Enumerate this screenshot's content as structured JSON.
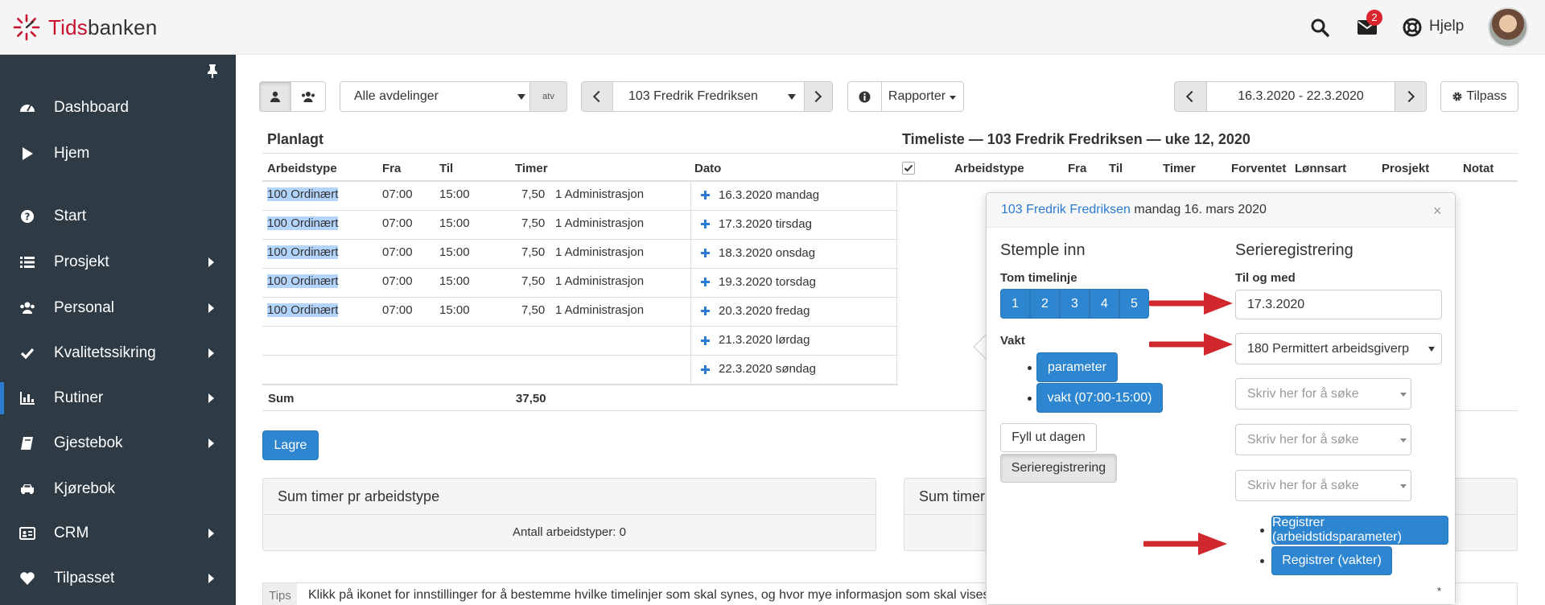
{
  "app": {
    "logo_part1": "Tids",
    "logo_part2": "banken",
    "notifications_count": "2",
    "help_label": "Hjelp"
  },
  "sidebar": {
    "items": [
      {
        "label": "Dashboard",
        "icon": "dashboard-icon",
        "has_submenu": false
      },
      {
        "label": "Hjem",
        "icon": "play-icon",
        "has_submenu": false
      },
      {
        "label": "Start",
        "icon": "question-circle-icon",
        "has_submenu": false
      },
      {
        "label": "Prosjekt",
        "icon": "list-icon",
        "has_submenu": true
      },
      {
        "label": "Personal",
        "icon": "users-icon",
        "has_submenu": true
      },
      {
        "label": "Kvalitetssikring",
        "icon": "check-icon",
        "has_submenu": true
      },
      {
        "label": "Rutiner",
        "icon": "bar-chart-icon",
        "has_submenu": true,
        "active": true
      },
      {
        "label": "Gjestebok",
        "icon": "book-icon",
        "has_submenu": true
      },
      {
        "label": "Kjørebok",
        "icon": "car-icon",
        "has_submenu": false
      },
      {
        "label": "CRM",
        "icon": "id-card-icon",
        "has_submenu": true
      },
      {
        "label": "Tilpasset",
        "icon": "heart-icon",
        "has_submenu": true
      }
    ]
  },
  "toolbar": {
    "department_select": "Alle avdelinger",
    "department_addon": "atv",
    "employee_select": "103 Fredrik Fredriksen",
    "reports_label": "Rapporter",
    "date_range": "16.3.2020 - 22.3.2020",
    "customize_label": "Tilpass"
  },
  "planned": {
    "title": "Planlagt",
    "headers": [
      "Arbeidstype",
      "Fra",
      "Til",
      "Timer",
      "Dato"
    ],
    "rows": [
      {
        "type": "100 Ordinært",
        "from": "07:00",
        "to": "15:00",
        "hours": "7,50",
        "dept": "1 Administrasjon",
        "date": "16.3.2020 mandag"
      },
      {
        "type": "100 Ordinært",
        "from": "07:00",
        "to": "15:00",
        "hours": "7,50",
        "dept": "1 Administrasjon",
        "date": "17.3.2020 tirsdag"
      },
      {
        "type": "100 Ordinært",
        "from": "07:00",
        "to": "15:00",
        "hours": "7,50",
        "dept": "1 Administrasjon",
        "date": "18.3.2020 onsdag"
      },
      {
        "type": "100 Ordinært",
        "from": "07:00",
        "to": "15:00",
        "hours": "7,50",
        "dept": "1 Administrasjon",
        "date": "19.3.2020 torsdag"
      },
      {
        "type": "100 Ordinært",
        "from": "07:00",
        "to": "15:00",
        "hours": "7,50",
        "dept": "1 Administrasjon",
        "date": "20.3.2020 fredag"
      },
      {
        "type": "",
        "from": "",
        "to": "",
        "hours": "",
        "dept": "",
        "date": "21.3.2020 lørdag"
      },
      {
        "type": "",
        "from": "",
        "to": "",
        "hours": "",
        "dept": "",
        "date": "22.3.2020 søndag"
      }
    ],
    "sum_label": "Sum",
    "sum_value": "37,50"
  },
  "timesheet": {
    "title": "Timeliste — 103 Fredrik Fredriksen — uke 12, 2020",
    "headers": [
      "Arbeidstype",
      "Fra",
      "Til",
      "Timer",
      "Forventet",
      "Lønnsart",
      "Prosjekt",
      "Notat"
    ]
  },
  "save_label": "Lagre",
  "panel_left": {
    "title": "Sum timer pr arbeidstype",
    "body": "Antall arbeidstyper: 0"
  },
  "panel_right": {
    "title": "Sum timer"
  },
  "tips": {
    "label": "Tips",
    "text": "Klikk på ikonet for innstillinger for å bestemme hvilke timelinjer som skal synes, og hvor mye informasjon som skal vises o"
  },
  "popover": {
    "title_link": "103 Fredrik Fredriksen",
    "title_rest": " mandag 16. mars 2020",
    "close": "×",
    "stamp_heading": "Stemple inn",
    "empty_line_label": "Tom timelinje",
    "number_buttons": [
      "1",
      "2",
      "3",
      "4",
      "5"
    ],
    "shift_label": "Vakt",
    "shift_buttons": [
      "parameter",
      "vakt (07:00-15:00)"
    ],
    "fill_day": "Fyll ut dagen",
    "series_toggle": "Serieregistrering",
    "series_heading": "Serieregistrering",
    "until_label": "Til og med",
    "until_value": "17.3.2020",
    "type_select": "180 Permittert arbeidsgiverp",
    "search_placeholder": "Skriv her for å søke",
    "register_param": "Registrer (arbeidstidsparameter)",
    "register_shifts": "Registrer (vakter)",
    "footnote": "*"
  },
  "colors": {
    "sidebar_bg": "#2e3a44",
    "primary": "#2e86d0",
    "brand_red": "#c8102e",
    "arrow_red": "#d1282e"
  }
}
